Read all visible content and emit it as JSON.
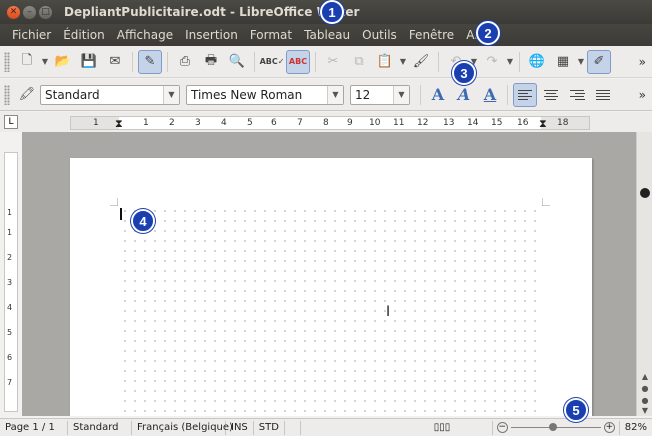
{
  "window": {
    "title": "DepliantPublicitaire.odt - LibreOffice Writer"
  },
  "menu": [
    {
      "label": "Fichier"
    },
    {
      "label": "Édition"
    },
    {
      "label": "Affichage"
    },
    {
      "label": "Insertion"
    },
    {
      "label": "Format"
    },
    {
      "label": "Tableau"
    },
    {
      "label": "Outils"
    },
    {
      "label": "Fenêtre"
    },
    {
      "label": "Aide"
    }
  ],
  "format_toolbar": {
    "paragraph_style": "Standard",
    "font_name": "Times New Roman",
    "font_size": "12"
  },
  "ruler": {
    "h_ticks": [
      "1",
      "1",
      "2",
      "3",
      "4",
      "5",
      "6",
      "7",
      "8",
      "9",
      "10",
      "11",
      "12",
      "13",
      "14",
      "15",
      "16",
      "18"
    ],
    "v_ticks": [
      "1",
      "1",
      "2",
      "3",
      "4",
      "5",
      "6",
      "7"
    ]
  },
  "status": {
    "page": "Page 1 / 1",
    "style": "Standard",
    "language": "Français (Belgique)",
    "insert_mode": "INS",
    "selection_mode": "STD",
    "zoom": "82%"
  },
  "markers": [
    "1",
    "2",
    "3",
    "4",
    "5"
  ],
  "colors": {
    "marker": "#1a3fb0",
    "titlebar": "#3c3b37",
    "accent_close": "#e95420"
  }
}
